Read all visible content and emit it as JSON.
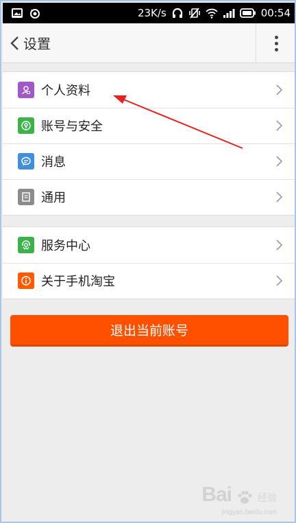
{
  "status_bar": {
    "network_speed": "23K/s",
    "time": "00:54",
    "icons": [
      "image-icon",
      "sync-icon",
      "headphones-icon",
      "vibrate-icon",
      "wifi-icon",
      "signal-icon",
      "battery-icon"
    ]
  },
  "header": {
    "title": "设置",
    "back_icon": "chevron-left-icon",
    "more_icon": "more-vertical-icon"
  },
  "groups": [
    {
      "items": [
        {
          "label": "个人资料",
          "icon": "profile-icon",
          "color": "#a258c8"
        },
        {
          "label": "账号与安全",
          "icon": "security-icon",
          "color": "#3cb24a"
        },
        {
          "label": "消息",
          "icon": "message-icon",
          "color": "#3f8fdc"
        },
        {
          "label": "通用",
          "icon": "general-icon",
          "color": "#8c8c8c"
        }
      ]
    },
    {
      "items": [
        {
          "label": "服务中心",
          "icon": "service-icon",
          "color": "#3cb24a"
        },
        {
          "label": "关于手机淘宝",
          "icon": "info-icon",
          "color": "#ff5a00"
        }
      ]
    }
  ],
  "logout_button": {
    "label": "退出当前账号",
    "color": "#ff5000"
  },
  "watermark": {
    "logo": "Bai",
    "sub": "经验",
    "url": "jingyan.baidu.com"
  },
  "annotation": {
    "color": "#e8211b",
    "points_to": "个人资料"
  }
}
